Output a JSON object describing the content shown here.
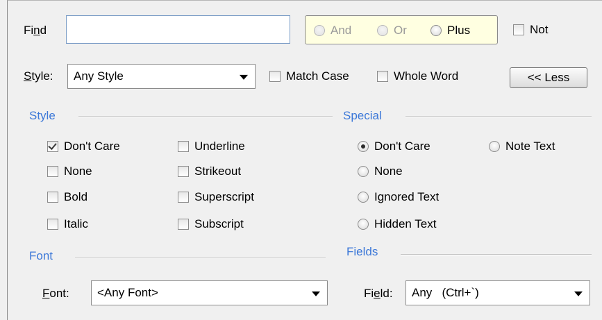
{
  "find": {
    "label_pre": "Fi",
    "label_ul": "n",
    "label_post": "d",
    "value": ""
  },
  "logic": {
    "and": "And",
    "or": "Or",
    "plus": "Plus",
    "not": "Not"
  },
  "style_row": {
    "label_ul": "S",
    "label_post": "tyle:",
    "selected": "Any Style",
    "match_case": "Match Case",
    "whole_word": "Whole Word",
    "less_button": "<< Less"
  },
  "style_section": {
    "title": "Style",
    "col1": [
      "Don't Care",
      "None",
      "Bold",
      "Italic"
    ],
    "col2": [
      "Underline",
      "Strikeout",
      "Superscript",
      "Subscript"
    ]
  },
  "special_section": {
    "title": "Special",
    "options": [
      "Don't Care",
      "None",
      "Ignored Text",
      "Hidden Text"
    ],
    "note_text": "Note Text"
  },
  "font_section": {
    "title": "Font",
    "label_ul": "F",
    "label_post": "ont:",
    "selected": "<Any Font>"
  },
  "fields_section": {
    "title": "Fields",
    "label_pre": "Fi",
    "label_ul": "e",
    "label_post": "ld:",
    "selected": "Any   (Ctrl+`)"
  },
  "colors": {
    "section_title": "#3c78d8",
    "group_bg": "#ffffe1"
  }
}
